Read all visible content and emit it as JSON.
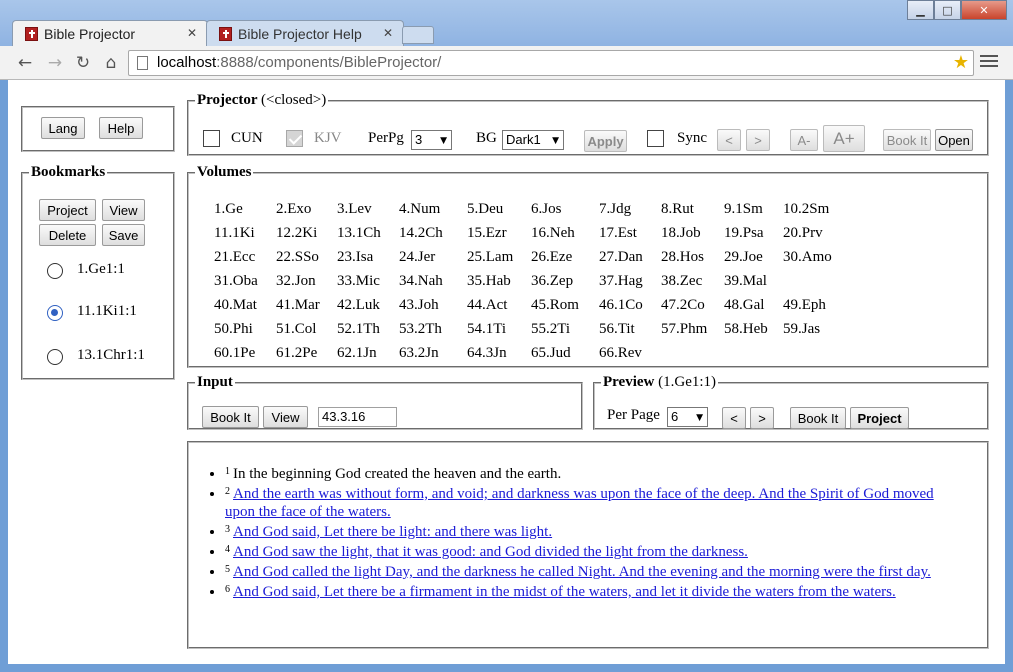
{
  "browser": {
    "tabs": [
      {
        "label": "Bible Projector"
      },
      {
        "label": "Bible Projector Help"
      }
    ],
    "url_host": "localhost",
    "url_path": ":8888/components/BibleProjector/",
    "window_buttons": {
      "minimize": "▁",
      "maximize": "□",
      "close": "✕"
    }
  },
  "top_buttons": {
    "lang": "Lang",
    "help": "Help"
  },
  "bookmarks": {
    "legend": "Bookmarks",
    "buttons": {
      "project": "Project",
      "view": "View",
      "delete": "Delete",
      "save": "Save"
    },
    "items": [
      {
        "label": "1.Ge1:1",
        "selected": false
      },
      {
        "label": "11.1Ki1:1",
        "selected": true
      },
      {
        "label": "13.1Chr1:1",
        "selected": false
      }
    ]
  },
  "projector": {
    "legend": "Projector",
    "status": "(<closed>)",
    "cun_label": "CUN",
    "kjv_label": "KJV",
    "perpg_label": "PerPg",
    "perpg_value": "3",
    "bg_label": "BG",
    "bg_value": "Dark1",
    "apply": "Apply",
    "sync_label": "Sync",
    "prev": "<",
    "next": ">",
    "font_smaller": "A-",
    "font_larger": "A+",
    "book_it": "Book It",
    "open": "Open"
  },
  "volumes": {
    "legend": "Volumes",
    "rows": [
      [
        "1.Ge",
        "2.Exo",
        "3.Lev",
        "4.Num",
        "5.Deu",
        "6.Jos",
        "7.Jdg",
        "8.Rut",
        "9.1Sm",
        "10.2Sm"
      ],
      [
        "11.1Ki",
        "12.2Ki",
        "13.1Ch",
        "14.2Ch",
        "15.Ezr",
        "16.Neh",
        "17.Est",
        "18.Job",
        "19.Psa",
        "20.Prv"
      ],
      [
        "21.Ecc",
        "22.SSo",
        "23.Isa",
        "24.Jer",
        "25.Lam",
        "26.Eze",
        "27.Dan",
        "28.Hos",
        "29.Joe",
        "30.Amo"
      ],
      [
        "31.Oba",
        "32.Jon",
        "33.Mic",
        "34.Nah",
        "35.Hab",
        "36.Zep",
        "37.Hag",
        "38.Zec",
        "39.Mal",
        ""
      ],
      [
        "40.Mat",
        "41.Mar",
        "42.Luk",
        "43.Joh",
        "44.Act",
        "45.Rom",
        "46.1Co",
        "47.2Co",
        "48.Gal",
        "49.Eph"
      ],
      [
        "50.Phi",
        "51.Col",
        "52.1Th",
        "53.2Th",
        "54.1Ti",
        "55.2Ti",
        "56.Tit",
        "57.Phm",
        "58.Heb",
        "59.Jas"
      ],
      [
        "60.1Pe",
        "61.2Pe",
        "62.1Jn",
        "63.2Jn",
        "64.3Jn",
        "65.Jud",
        "66.Rev",
        "",
        "",
        ""
      ]
    ]
  },
  "input": {
    "legend": "Input",
    "book_it": "Book It",
    "view": "View",
    "value": "43.3.16"
  },
  "preview": {
    "legend": "Preview",
    "ref": "(1.Ge1:1)",
    "per_page_label": "Per Page",
    "per_page_value": "6",
    "prev": "<",
    "next": ">",
    "book_it": "Book It",
    "project": "Project"
  },
  "verses": [
    {
      "num": "1",
      "text": "In the beginning God created the heaven and the earth.",
      "link": false
    },
    {
      "num": "2",
      "text": "And the earth was without form, and void; and darkness was upon the face of the deep. And the Spirit of God moved upon the face of the waters.",
      "link": true
    },
    {
      "num": "3",
      "text": "And God said, Let there be light: and there was light.",
      "link": true
    },
    {
      "num": "4",
      "text": "And God saw the light, that it was good: and God divided the light from the darkness.",
      "link": true
    },
    {
      "num": "5",
      "text": "And God called the light Day, and the darkness he called Night. And the evening and the morning were the first day.",
      "link": true
    },
    {
      "num": "6",
      "text": "And God said, Let there be a firmament in the midst of the waters, and let it divide the waters from the waters.",
      "link": true
    }
  ],
  "colors": {
    "link": "#1b1bd6",
    "radio_selected": "#3061c2",
    "window_frame": "#6f9ed6"
  }
}
